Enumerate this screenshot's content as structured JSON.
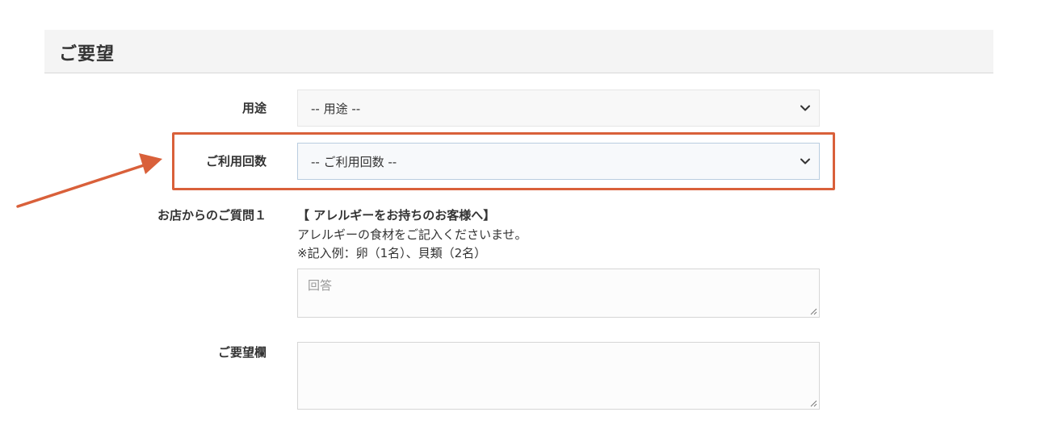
{
  "section": {
    "title": "ご要望"
  },
  "form": {
    "purpose": {
      "label": "用途",
      "selected": "-- 用途 --"
    },
    "visit_count": {
      "label": "ご利用回数",
      "selected": "-- ご利用回数 --"
    },
    "question1": {
      "label": "お店からのご質問１",
      "heading": "【 アレルギーをお持ちのお客様へ】",
      "line1": "アレルギーの食材をご記入くださいませ。",
      "line2": "※記入例：卵（1名）、貝類（2名）",
      "answer_placeholder": "回答"
    },
    "request": {
      "label": "ご要望欄"
    }
  },
  "colors": {
    "highlight": "#d9603a",
    "header_bg": "#f4f4f4"
  },
  "icons": {
    "select_chevron": "chevron-down-icon",
    "pointer_arrow": "arrow-icon",
    "resize": "resize-grip-icon"
  }
}
